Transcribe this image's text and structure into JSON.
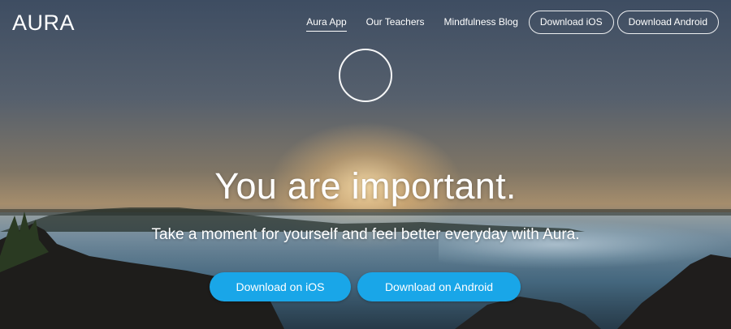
{
  "brand": {
    "logo": "AURA"
  },
  "nav": {
    "links": [
      {
        "label": "Aura App",
        "active": true
      },
      {
        "label": "Our Teachers",
        "active": false
      },
      {
        "label": "Mindfulness Blog",
        "active": false
      }
    ],
    "download_ios": "Download iOS",
    "download_android": "Download Android"
  },
  "hero": {
    "headline": "You are important.",
    "subline": "Take a moment for yourself and feel better everyday with Aura.",
    "cta_ios": "Download on iOS",
    "cta_android": "Download on Android"
  },
  "colors": {
    "accent": "#19a6e8",
    "text": "#ffffff"
  },
  "icons": {
    "logo_mark": "ring-icon"
  }
}
